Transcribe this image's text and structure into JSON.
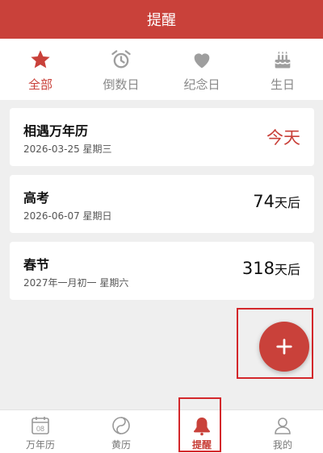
{
  "header": {
    "title": "提醒"
  },
  "categories": [
    {
      "label": "全部",
      "icon": "star-icon",
      "active": true
    },
    {
      "label": "倒数日",
      "icon": "alarm-clock-icon",
      "active": false
    },
    {
      "label": "纪念日",
      "icon": "heart-icon",
      "active": false
    },
    {
      "label": "生日",
      "icon": "cake-icon",
      "active": false
    }
  ],
  "reminders": [
    {
      "name": "相遇万年历",
      "date": "2026-03-25 星期三",
      "count_text": "今天",
      "count_num": "",
      "count_unit": ""
    },
    {
      "name": "高考",
      "date": "2026-06-07 星期日",
      "count_text": "",
      "count_num": "74",
      "count_unit": "天后"
    },
    {
      "name": "春节",
      "date": "2027年一月初一 星期六",
      "count_text": "",
      "count_num": "318",
      "count_unit": "天后"
    }
  ],
  "add_button": {
    "icon": "plus-icon"
  },
  "tabbar": [
    {
      "label": "万年历",
      "icon": "calendar-icon",
      "badge": "08"
    },
    {
      "label": "黄历",
      "icon": "yin-yang-icon"
    },
    {
      "label": "提醒",
      "icon": "bell-icon"
    },
    {
      "label": "我的",
      "icon": "user-icon"
    }
  ],
  "colors": {
    "brand": "#c9413a",
    "highlight_box": "#d3272b",
    "inactive_icon": "#999999"
  }
}
